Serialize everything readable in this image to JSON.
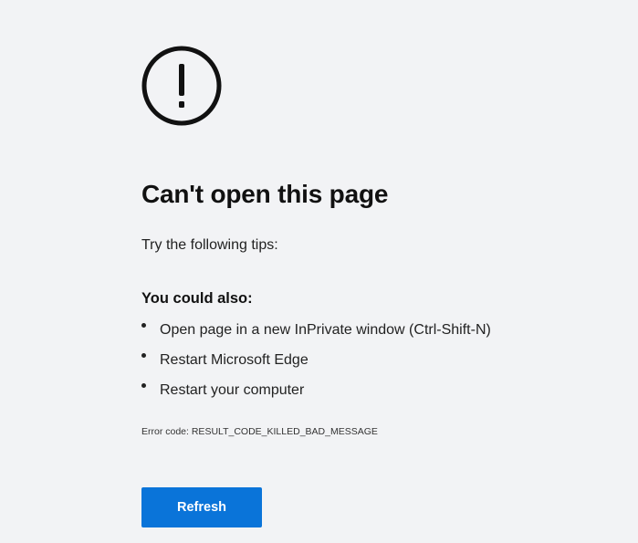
{
  "error_page": {
    "icon": "exclamation-circle-icon",
    "title": "Can't open this page",
    "subtitle": "Try the following tips:",
    "also_heading": "You could also:",
    "tips": [
      "Open page in a new InPrivate window (Ctrl-Shift-N)",
      "Restart Microsoft Edge",
      "Restart your computer"
    ],
    "error_code": "Error code: RESULT_CODE_KILLED_BAD_MESSAGE",
    "refresh_label": "Refresh"
  },
  "colors": {
    "background": "#f2f3f5",
    "accent": "#0a74d9",
    "text": "#1a1a1a"
  }
}
